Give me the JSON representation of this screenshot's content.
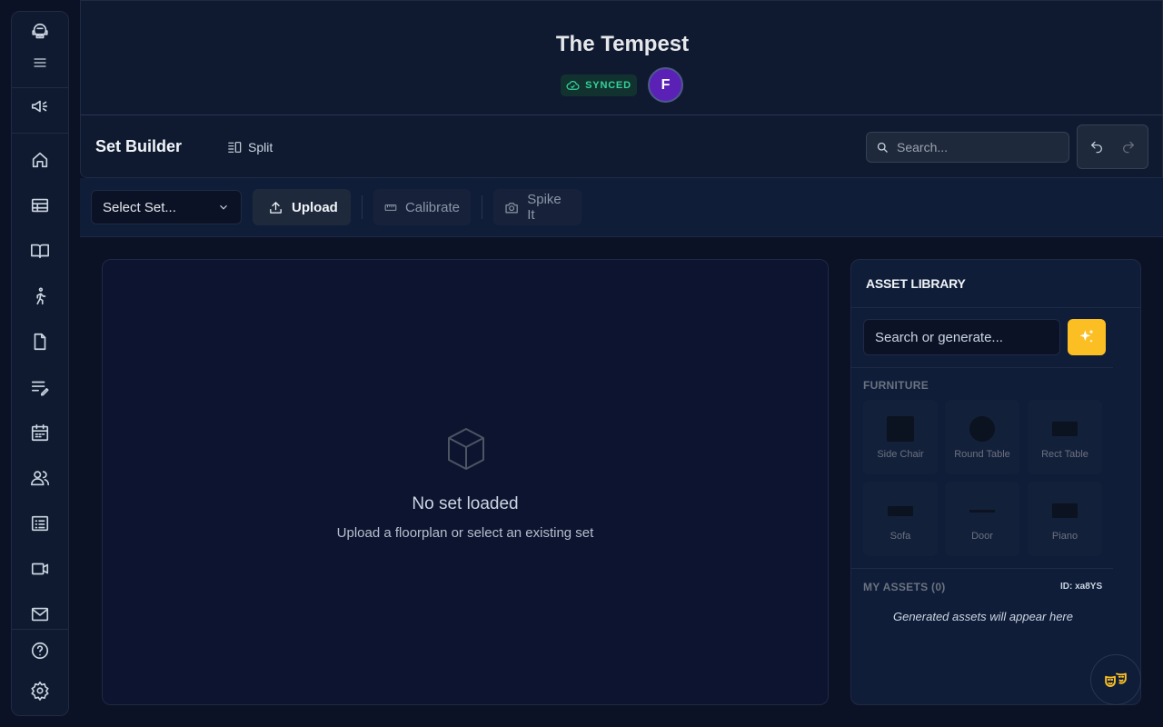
{
  "app": {
    "title": "The Tempest",
    "sync_status": "SYNCED",
    "user_initial": "F"
  },
  "sidebar": {
    "items": [
      {
        "name": "app-logo",
        "icon": "headset-logo-icon"
      },
      {
        "name": "menu",
        "icon": "hamburger-icon"
      },
      {
        "name": "announcements",
        "icon": "megaphone-icon"
      },
      {
        "name": "home",
        "icon": "home-icon"
      },
      {
        "name": "table",
        "icon": "table-icon"
      },
      {
        "name": "script",
        "icon": "open-book-icon"
      },
      {
        "name": "blocking",
        "icon": "walking-person-icon"
      },
      {
        "name": "documents",
        "icon": "file-icon"
      },
      {
        "name": "notes",
        "icon": "edit-list-icon"
      },
      {
        "name": "calendar",
        "icon": "calendar-icon"
      },
      {
        "name": "people",
        "icon": "users-icon"
      },
      {
        "name": "list",
        "icon": "list-icon"
      },
      {
        "name": "video",
        "icon": "video-icon"
      },
      {
        "name": "mail",
        "icon": "mail-icon"
      },
      {
        "name": "help",
        "icon": "help-circle-icon"
      },
      {
        "name": "settings",
        "icon": "gear-icon"
      }
    ]
  },
  "subheader": {
    "page_title": "Set Builder",
    "split_label": "Split",
    "search_placeholder": "Search..."
  },
  "toolbar": {
    "select_placeholder": "Select Set...",
    "upload_label": "Upload",
    "calibrate_label": "Calibrate",
    "spike_label": "Spike It"
  },
  "canvas": {
    "empty_title": "No set loaded",
    "empty_subtitle": "Upload a floorplan or select an existing set"
  },
  "asset_library": {
    "title": "ASSET LIBRARY",
    "search_placeholder": "Search or generate...",
    "furniture_heading": "FURNITURE",
    "furniture": [
      {
        "label": "Side Chair"
      },
      {
        "label": "Round Table"
      },
      {
        "label": "Rect Table"
      },
      {
        "label": "Sofa"
      },
      {
        "label": "Door"
      },
      {
        "label": "Piano"
      }
    ],
    "my_assets_heading": "MY ASSETS (0)",
    "asset_id": "ID: xa8YS",
    "empty_note": "Generated assets will appear here"
  },
  "colors": {
    "background": "#0b1226",
    "accent": "#fbbf24",
    "synced": "#34d399",
    "avatar": "#5b21b6"
  }
}
